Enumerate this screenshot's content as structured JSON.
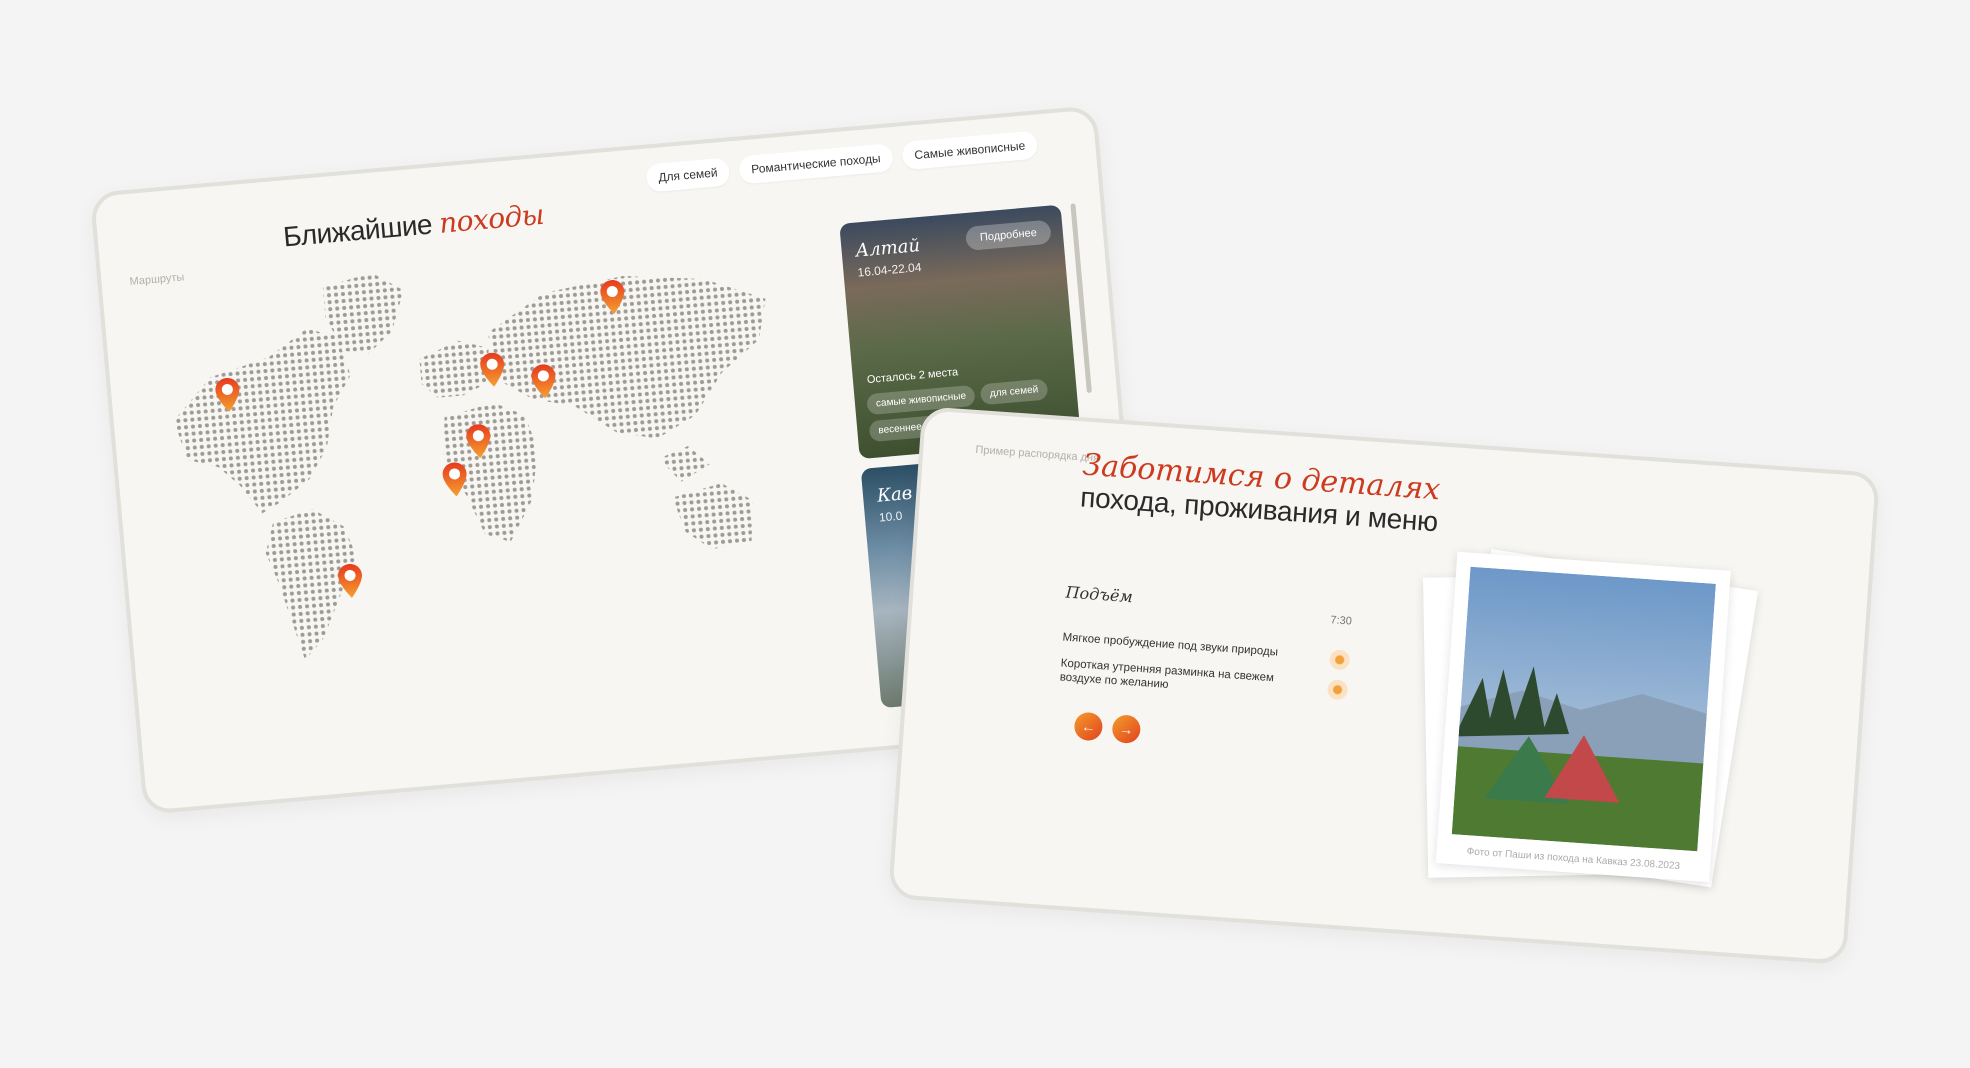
{
  "routes_panel": {
    "section_label": "Маршруты",
    "title_plain": "Ближайшие ",
    "title_accent": "походы",
    "filters": [
      "Для семей",
      "Романтические походы",
      "Самые живописные"
    ],
    "destinations": [
      {
        "name": "Алтай",
        "dates": "16.04-22.04",
        "more_label": "Подробнее",
        "places_left": "Осталось 2 места",
        "tags": [
          "самые живописные",
          "для семей",
          "весеннее цветение"
        ]
      },
      {
        "name": "Кав",
        "dates": "10.0"
      }
    ],
    "pin_color": "#e8601c"
  },
  "schedule_panel": {
    "section_label": "Пример распорядка дня",
    "title_accent": "Заботимся о деталях",
    "title_plain": "похода, проживания и меню",
    "block_title": "Подъём",
    "time": "7:30",
    "items": [
      "Мягкое пробуждение под звуки природы",
      "Короткая утренняя разминка на свежем воздухе по желанию"
    ],
    "prev_label": "←",
    "next_label": "→",
    "photo_caption": "Фото от Паши из похода на Кавказ 23.08.2023"
  },
  "colors": {
    "accent": "#cc3a1f",
    "background": "#f4f4f4",
    "card": "#f7f6f2"
  }
}
